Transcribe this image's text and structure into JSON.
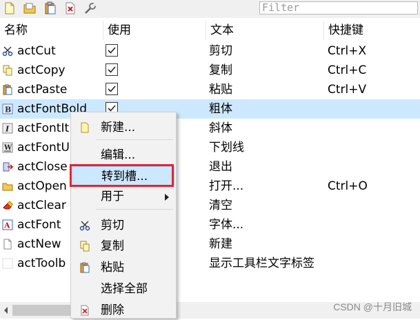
{
  "toolbar": {
    "buttons": [
      "new-document-icon",
      "open-folder-icon",
      "paste-icon",
      "delete-icon",
      "wrench-icon"
    ],
    "filter_placeholder": "Filter"
  },
  "columns": {
    "name": "名称",
    "used": "使用",
    "text": "文本",
    "shortcut": "快捷键"
  },
  "rows": [
    {
      "name": "actCut",
      "icon": "scissors-icon",
      "checked": true,
      "text": "剪切",
      "shortcut": "Ctrl+X",
      "selected": false
    },
    {
      "name": "actCopy",
      "icon": "copy-icon",
      "checked": true,
      "text": "复制",
      "shortcut": "Ctrl+C",
      "selected": false
    },
    {
      "name": "actPaste",
      "icon": "paste-icon",
      "checked": true,
      "text": "粘贴",
      "shortcut": "Ctrl+V",
      "selected": false
    },
    {
      "name": "actFontBold",
      "icon": "bold-icon",
      "checked": true,
      "text": "粗体",
      "shortcut": "",
      "selected": true
    },
    {
      "name": "actFontIt",
      "icon": "italic-icon",
      "checked": false,
      "text": "斜体",
      "shortcut": "",
      "selected": false
    },
    {
      "name": "actFontU",
      "icon": "underline-icon",
      "checked": false,
      "text": "下划线",
      "shortcut": "",
      "selected": false
    },
    {
      "name": "actClose",
      "icon": "exit-icon",
      "checked": false,
      "text": "退出",
      "shortcut": "",
      "selected": false
    },
    {
      "name": "actOpen",
      "icon": "folder-icon",
      "checked": false,
      "text": "打开...",
      "shortcut": "Ctrl+O",
      "selected": false
    },
    {
      "name": "actClear",
      "icon": "eraser-icon",
      "checked": false,
      "text": "清空",
      "shortcut": "",
      "selected": false
    },
    {
      "name": "actFont",
      "icon": "font-icon",
      "checked": false,
      "text": "字体...",
      "shortcut": "",
      "selected": false
    },
    {
      "name": "actNew",
      "icon": "new-document-icon",
      "checked": false,
      "text": "新建",
      "shortcut": "",
      "selected": false
    },
    {
      "name": "actToolb",
      "icon": "blank-icon",
      "checked": false,
      "text": "显示工具栏文字标签",
      "shortcut": "",
      "selected": false
    }
  ],
  "context_menu": {
    "items": [
      {
        "label": "新建...",
        "icon": "new-document-icon"
      },
      {
        "label": "编辑...",
        "icon": ""
      },
      {
        "label": "转到槽...",
        "icon": "",
        "highlighted": true
      },
      {
        "label": "用于",
        "icon": "",
        "submenu": true
      },
      {
        "label": "剪切",
        "icon": "scissors-icon"
      },
      {
        "label": "复制",
        "icon": "copy-icon"
      },
      {
        "label": "粘贴",
        "icon": "paste-icon"
      },
      {
        "label": "选择全部",
        "icon": ""
      },
      {
        "label": "删除",
        "icon": "delete-icon"
      }
    ]
  },
  "watermark": "CSDN @十月旧城",
  "colors": {
    "selection": "#cce8ff",
    "highlight_border": "#e0262e",
    "menu_bg": "#f2f2f2"
  }
}
